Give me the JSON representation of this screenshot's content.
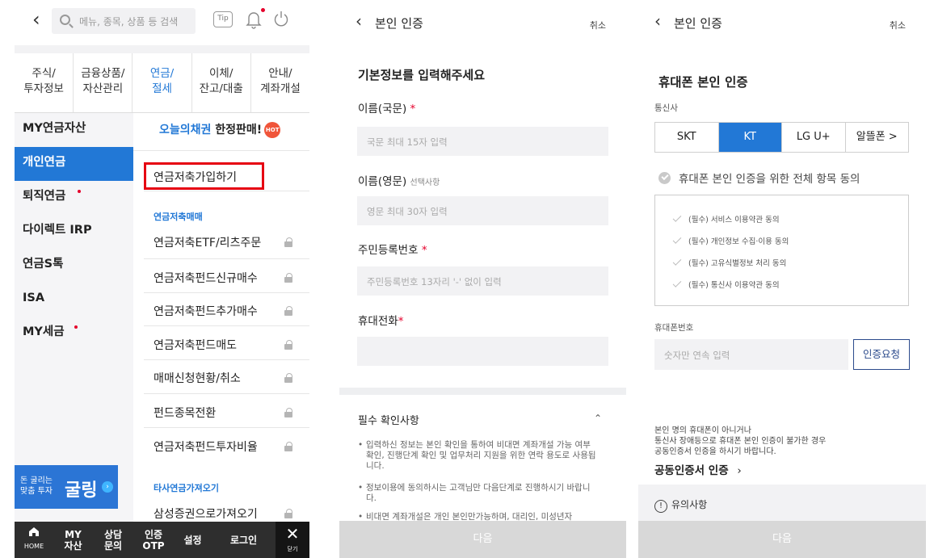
{
  "panel1": {
    "search_placeholder": "메뉴, 종목, 상품 등 검색",
    "tip_label": "Tip",
    "tabs": [
      {
        "line1": "주식/",
        "line2": "투자정보"
      },
      {
        "line1": "금융상품/",
        "line2": "자산관리"
      },
      {
        "line1": "연금/",
        "line2": "절세"
      },
      {
        "line1": "이체/",
        "line2": "잔고/대출"
      },
      {
        "line1": "안내/",
        "line2": "계좌개설"
      }
    ],
    "left_nav": [
      "MY연금자산",
      "개인연금",
      "퇴직연금",
      "다이렉트 IRP",
      "연금S톡",
      "ISA",
      "MY세금"
    ],
    "promo": {
      "part1": "오늘의채권",
      "part2": " 한정판매!",
      "badge": "HOT"
    },
    "highlight_item": "연금저축가입하기",
    "section1_title": "연금저축매매",
    "section1_items": [
      "연금저축ETF/리츠주문",
      "연금저축펀드신규매수",
      "연금저축펀드추가매수",
      "연금저축펀드매도",
      "매매신청현황/취소",
      "펀드종목전환",
      "연금저축펀드투자비율"
    ],
    "section2_title": "타사연금가져오기",
    "section2_items": [
      "삼성증권으로가져오기"
    ],
    "banner": {
      "line1": "돈 굴리는",
      "line2": "맞춤 투자",
      "brand": "굴링"
    },
    "bottom_bar": {
      "home": "HOME",
      "items": [
        {
          "line1": "MY",
          "line2": "자산"
        },
        {
          "line1": "상담",
          "line2": "문의"
        },
        {
          "line1": "인증",
          "line2": "OTP"
        },
        {
          "line1": "설정",
          "line2": ""
        },
        {
          "line1": "로그인",
          "line2": ""
        }
      ],
      "close": "닫기"
    }
  },
  "panel2": {
    "title": "본인 인증",
    "cancel": "취소",
    "heading": "기본정보를 입력해주세요",
    "fields": [
      {
        "label": "이름(국문)",
        "required": "*",
        "optional": "",
        "placeholder": "국문 최대 15자 입력"
      },
      {
        "label": "이름(영문)",
        "required": "",
        "optional": "선택사항",
        "placeholder": "영문 최대 30자 입력"
      },
      {
        "label": "주민등록번호",
        "required": "*",
        "optional": "",
        "placeholder": "주민등록번호 13자리 '-' 없이 입력"
      },
      {
        "label": "휴대전화",
        "required": "*",
        "optional": "",
        "placeholder": ""
      }
    ],
    "confirm_title": "필수 확인사항",
    "bullets": [
      "입력하신 정보는 본인 확인을 통하여 비대면 계좌개설 가능 여부 확인, 진행단계 확인 및 업무처리 지원을 위한 연락 용도로 사용됩니다.",
      "정보이용에 동의하시는 고객님만 다음단계로 진행하시기 바랍니다.",
      "비대면 계좌개설은 개인 본인만가능하며, 대리인, 미성년자"
    ],
    "next": "다음"
  },
  "panel3": {
    "title": "본인 인증",
    "cancel": "취소",
    "heading": "휴대폰 본인 인증",
    "carrier_label": "통신사",
    "carriers": [
      "SKT",
      "KT",
      "LG U+",
      "알뜰폰 >"
    ],
    "selected_carrier": "KT",
    "agree_all": "휴대폰 본인 인증을 위한 전체 항목 동의",
    "terms": [
      "(필수) 서비스 이용약관 동의",
      "(필수) 개인정보 수집·이용 동의",
      "(필수) 고유식별정보 처리 동의",
      "(필수) 통신사 이용약관 동의"
    ],
    "phone_label": "휴대폰번호",
    "phone_placeholder": "숫자만 연속 입력",
    "request_button": "인증요청",
    "notice_lines": [
      "본인 명의 휴대폰이 아니거나",
      "통신사 장애등으로 휴대폰 본인 인증이 불가한 경우",
      "공동인증서 인증을 하시기 바랍니다."
    ],
    "cert_link": "공동인증서 인증",
    "caution": "유의사항",
    "next": "다음"
  },
  "colors": {
    "accent": "#2278d6",
    "highlight_border": "#e60012",
    "bottom_bar": "#2e2e2e"
  }
}
